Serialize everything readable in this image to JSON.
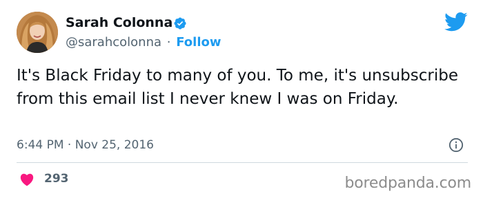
{
  "author": {
    "name": "Sarah Colonna",
    "handle": "@sarahcolonna",
    "separator": "·",
    "follow_label": "Follow"
  },
  "tweet": {
    "text": "It's Black Friday to many of you. To me, it's unsubscribe from this email list I never knew I was on Friday.",
    "timestamp": "6:44 PM · Nov 25, 2016",
    "like_count": "293"
  },
  "watermark": "boredpanda.com",
  "icons": {
    "verified": "verified-badge-icon",
    "brand": "twitter-bird-icon",
    "info": "info-icon",
    "like": "heart-icon"
  },
  "colors": {
    "accent": "#1d9bf0",
    "text": "#0f1419",
    "muted": "#536471",
    "like": "#f91880",
    "divider": "#cfd9de"
  }
}
